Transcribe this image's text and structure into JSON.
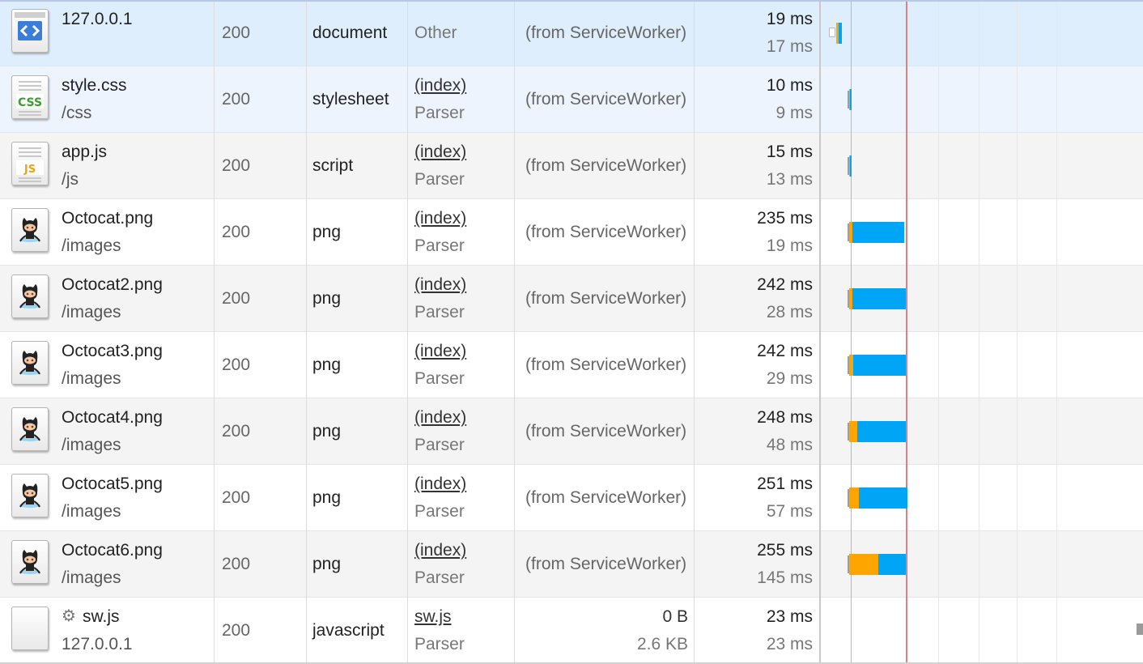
{
  "colors": {
    "row_selected": "#dfeefd",
    "row_hover": "#eef4fd",
    "row_even": "#f4f4f4",
    "row_odd": "#ffffff",
    "bar_waiting": "#ffa500",
    "bar_download": "#00a6f5",
    "bar_queued": "#9e9e9e",
    "dom_content_line": "#a9b4f0",
    "load_line": "#e07f7f"
  },
  "requests": [
    {
      "name": "127.0.0.1",
      "path": "",
      "status": "200",
      "type": "document",
      "initiator": "Other",
      "initiator_sub": "",
      "size": "(from ServiceWorker)",
      "size_sub": "",
      "time": "19 ms",
      "latency": "17 ms",
      "icon": "html-document-icon",
      "waterfall": {
        "queued": 0,
        "waiting": 3,
        "download": 4
      }
    },
    {
      "name": "style.css",
      "path": "/css",
      "status": "200",
      "type": "stylesheet",
      "initiator": "(index)",
      "initiator_sub": "Parser",
      "size": "(from ServiceWorker)",
      "size_sub": "",
      "time": "10 ms",
      "latency": "9 ms",
      "icon": "css-file-icon",
      "waterfall": {
        "queued": 2,
        "waiting": 1,
        "download": 2
      }
    },
    {
      "name": "app.js",
      "path": "/js",
      "status": "200",
      "type": "script",
      "initiator": "(index)",
      "initiator_sub": "Parser",
      "size": "(from ServiceWorker)",
      "size_sub": "",
      "time": "15 ms",
      "latency": "13 ms",
      "icon": "js-file-icon",
      "waterfall": {
        "queued": 2,
        "waiting": 1,
        "download": 2
      }
    },
    {
      "name": "Octocat.png",
      "path": "/images",
      "status": "200",
      "type": "png",
      "initiator": "(index)",
      "initiator_sub": "Parser",
      "size": "(from ServiceWorker)",
      "size_sub": "",
      "time": "235 ms",
      "latency": "19 ms",
      "icon": "octocat-image-icon",
      "waterfall": {
        "queued": 2,
        "waiting": 4,
        "download": 64
      }
    },
    {
      "name": "Octocat2.png",
      "path": "/images",
      "status": "200",
      "type": "png",
      "initiator": "(index)",
      "initiator_sub": "Parser",
      "size": "(from ServiceWorker)",
      "size_sub": "",
      "time": "242 ms",
      "latency": "28 ms",
      "icon": "octocat-image-icon",
      "waterfall": {
        "queued": 2,
        "waiting": 4,
        "download": 66
      }
    },
    {
      "name": "Octocat3.png",
      "path": "/images",
      "status": "200",
      "type": "png",
      "initiator": "(index)",
      "initiator_sub": "Parser",
      "size": "(from ServiceWorker)",
      "size_sub": "",
      "time": "242 ms",
      "latency": "29 ms",
      "icon": "octocat-image-icon",
      "waterfall": {
        "queued": 2,
        "waiting": 5,
        "download": 65
      }
    },
    {
      "name": "Octocat4.png",
      "path": "/images",
      "status": "200",
      "type": "png",
      "initiator": "(index)",
      "initiator_sub": "Parser",
      "size": "(from ServiceWorker)",
      "size_sub": "",
      "time": "248 ms",
      "latency": "48 ms",
      "icon": "octocat-image-icon",
      "waterfall": {
        "queued": 2,
        "waiting": 10,
        "download": 60
      }
    },
    {
      "name": "Octocat5.png",
      "path": "/images",
      "status": "200",
      "type": "png",
      "initiator": "(index)",
      "initiator_sub": "Parser",
      "size": "(from ServiceWorker)",
      "size_sub": "",
      "time": "251 ms",
      "latency": "57 ms",
      "icon": "octocat-image-icon",
      "waterfall": {
        "queued": 2,
        "waiting": 12,
        "download": 60
      }
    },
    {
      "name": "Octocat6.png",
      "path": "/images",
      "status": "200",
      "type": "png",
      "initiator": "(index)",
      "initiator_sub": "Parser",
      "size": "(from ServiceWorker)",
      "size_sub": "",
      "time": "255 ms",
      "latency": "145 ms",
      "icon": "octocat-image-icon",
      "waterfall": {
        "queued": 2,
        "waiting": 36,
        "download": 34
      }
    },
    {
      "name": "sw.js",
      "path": "127.0.0.1",
      "status": "200",
      "type": "javascript",
      "initiator": "sw.js",
      "initiator_sub": "Parser",
      "size": "0 B",
      "size_sub": "2.6 KB",
      "time": "23 ms",
      "latency": "23 ms",
      "icon": "blank-file-icon",
      "gear": "gear-icon",
      "waterfall": null
    }
  ]
}
